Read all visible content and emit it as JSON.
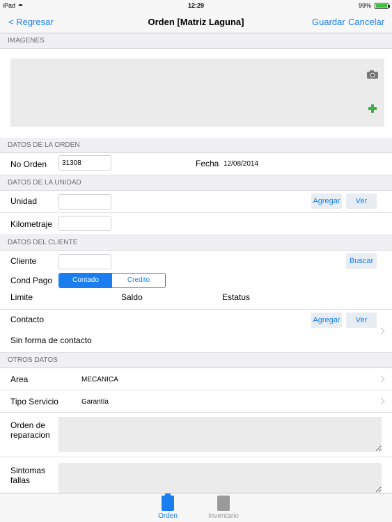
{
  "status_bar": {
    "device": "iPad",
    "time": "12:29",
    "battery": "99%",
    "battery_level": 0.99
  },
  "nav": {
    "back_label": "< Regresar",
    "title": "Orden [Matriz Laguna]",
    "save_label": "Guardar",
    "cancel_label": "Cancelar"
  },
  "sections": {
    "imagenes": "IMAGENES",
    "datos_orden": "DATOS DE LA ORDEN",
    "datos_unidad": "DATOS DE LA UNIDAD",
    "datos_cliente": "DATOS DEL CLIENTE",
    "otros_datos": "OTROS DATOS"
  },
  "orden": {
    "no_orden_label": "No Orden",
    "no_orden_value": "31308",
    "fecha_label": "Fecha",
    "fecha_value": "12/08/2014"
  },
  "unidad": {
    "unidad_label": "Unidad",
    "agregar_label": "Agregar",
    "ver_label": "Ver",
    "kilometraje_label": "Kilometraje"
  },
  "cliente": {
    "cliente_label": "Cliente",
    "buscar_label": "Buscar",
    "cond_pago_label": "Cond Pago",
    "cond_pago_options": [
      "Contado",
      "Credito"
    ],
    "cond_pago_selected": "Contado",
    "limite_label": "Limite",
    "saldo_label": "Saldo",
    "estatus_label": "Estatus",
    "contacto_label": "Contacto",
    "contacto_agregar": "Agregar",
    "contacto_ver": "Ver",
    "sin_contacto": "Sin forma de contacto"
  },
  "otros": {
    "area_label": "Area",
    "area_value": "MECANICA",
    "tipo_servicio_label": "Tipo Servicio",
    "tipo_servicio_value": "Garantía",
    "orden_reparacion_label": "Orden de reparacion",
    "sintomas_label": "Sintomas fallas"
  },
  "tabs": [
    {
      "label": "Orden",
      "active": true
    },
    {
      "label": "Inventario",
      "active": false
    }
  ],
  "colors": {
    "accent": "#1a7ef0",
    "add": "#3cb043",
    "section_bg": "#efeff4"
  }
}
